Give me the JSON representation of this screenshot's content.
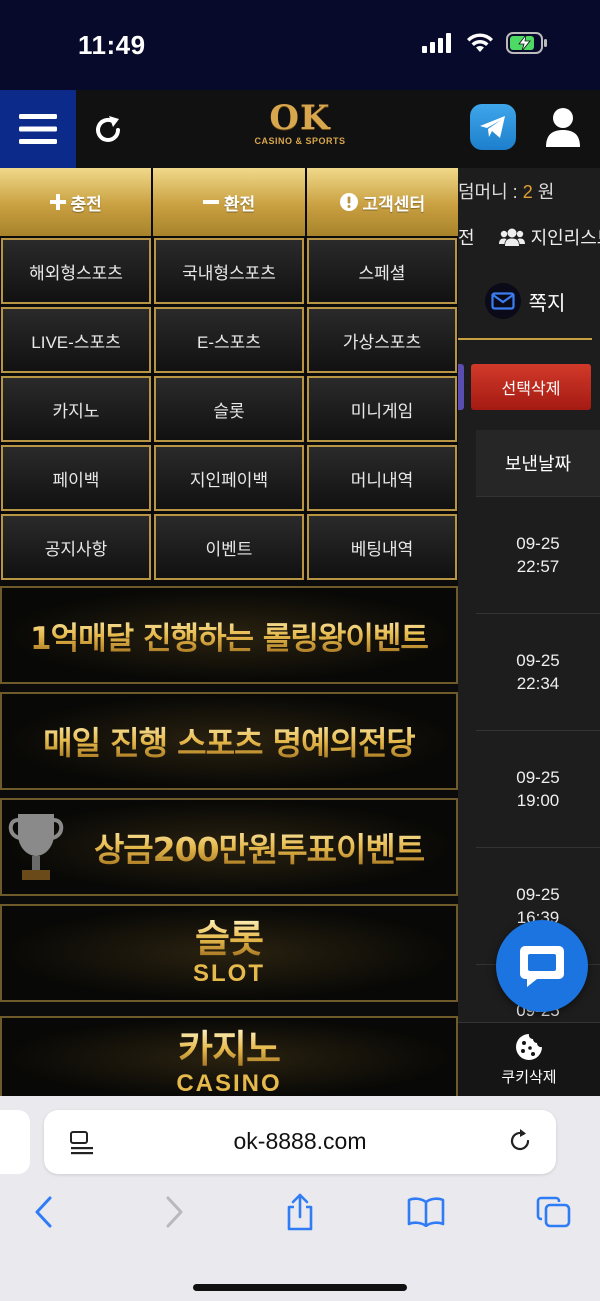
{
  "status": {
    "time": "11:49"
  },
  "header": {
    "logo_main": "OK",
    "logo_sub": "CASINO & SPORTS"
  },
  "menu": {
    "top_buttons": [
      {
        "label": "충전",
        "icon": "plus-icon"
      },
      {
        "label": "환전",
        "icon": "minus-icon"
      },
      {
        "label": "고객센터",
        "icon": "alert-circle-icon"
      }
    ],
    "grid": [
      "해외형스포츠",
      "국내형스포츠",
      "스페셜",
      "LIVE-스포츠",
      "E-스포츠",
      "가상스포츠",
      "카지노",
      "슬롯",
      "미니게임",
      "페이백",
      "지인페이백",
      "머니내역",
      "공지사항",
      "이벤트",
      "베팅내역"
    ],
    "banners": [
      {
        "text": "1억매달 진행하는 롤링왕이벤트",
        "sub": ""
      },
      {
        "text": "매일 진행 스포츠 명예의전당",
        "sub": ""
      },
      {
        "text": "상금200만원투표이벤트",
        "sub": ""
      },
      {
        "text": "슬롯",
        "sub": "SLOT"
      },
      {
        "text": "카지노",
        "sub": "CASINO"
      }
    ]
  },
  "background": {
    "money_label": "덤머니 : ",
    "money_value": "2",
    "money_unit": " 원",
    "prev_tab_fragment": "전",
    "friend_list": "지인리스트",
    "message_tab": "쪽지",
    "bulk_delete": "선택삭제",
    "sent_date_header": "보낸날짜",
    "dates": [
      {
        "date": "09-25",
        "time": "22:57"
      },
      {
        "date": "09-25",
        "time": "22:34"
      },
      {
        "date": "09-25",
        "time": "19:00"
      },
      {
        "date": "09-25",
        "time": "16:39"
      },
      {
        "date": "09-25",
        "time": ""
      }
    ],
    "cookie_delete": "쿠키삭제"
  },
  "browser": {
    "url": "ok-8888.com"
  },
  "colors": {
    "gold": "#c9a041",
    "menu_blue": "#0b2a8a",
    "delete_red": "#c0281c",
    "chat_blue": "#1c74e0"
  }
}
